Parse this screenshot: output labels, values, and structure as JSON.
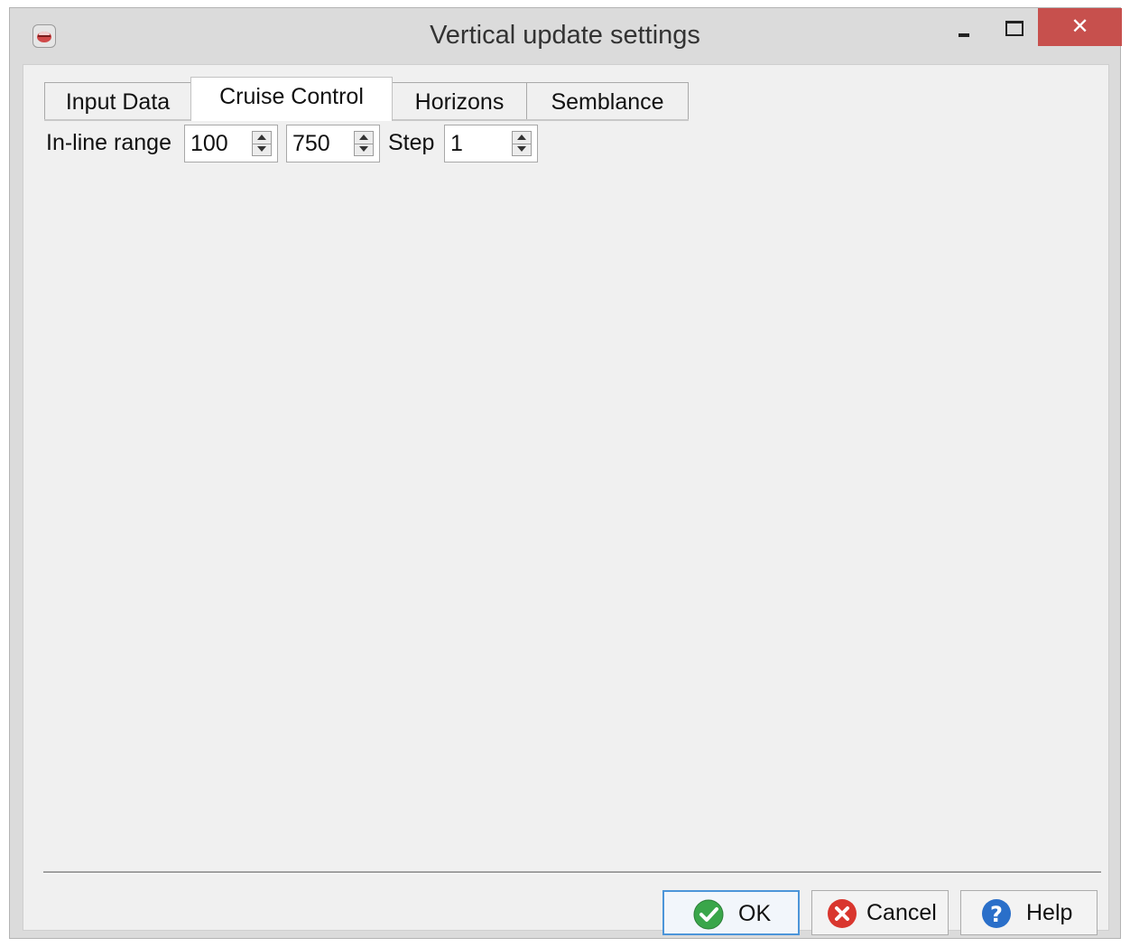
{
  "window": {
    "title": "Vertical update settings",
    "controls": {
      "minimize": "minimize-icon",
      "maximize": "maximize-icon",
      "close": "close-icon",
      "close_glyph": "✕"
    }
  },
  "tabs": [
    {
      "label": "Input Data",
      "active": false
    },
    {
      "label": "Cruise Control",
      "active": true
    },
    {
      "label": "Horizons",
      "active": false
    },
    {
      "label": "Semblance",
      "active": false
    }
  ],
  "cruise_control": {
    "inline_range_label": "In-line range",
    "range_start": "100",
    "range_end": "750",
    "step_label": "Step",
    "step_value": "1"
  },
  "buttons": {
    "ok": "OK",
    "cancel": "Cancel",
    "help": "Help"
  },
  "colors": {
    "close_button": "#c7504d",
    "ok_icon": "#3aa64a",
    "cancel_icon": "#d9362e",
    "help_icon": "#2a6fc9",
    "default_button_border": "#4c95d9"
  }
}
